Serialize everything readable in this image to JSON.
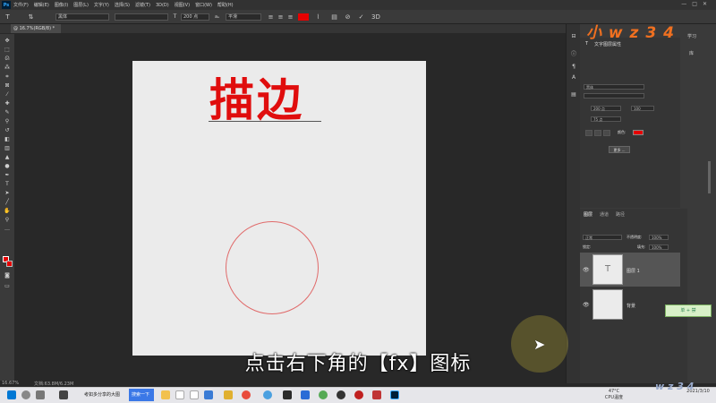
{
  "menubar": {
    "logo": "Ps",
    "items": [
      "文件(F)",
      "编辑(E)",
      "图像(I)",
      "图层(L)",
      "文字(Y)",
      "选择(S)",
      "滤镜(T)",
      "3D(D)",
      "视图(V)",
      "窗口(W)",
      "帮助(H)"
    ],
    "window_controls": "—□✕"
  },
  "options_bar": {
    "font_family": "黑体",
    "font_size": "200 点",
    "antialias": "平滑",
    "text_color": "#e60000"
  },
  "document": {
    "tab_label": "@ 16.7%(RGB/8) *",
    "canvas_text": "描边"
  },
  "subtitle": "点击右下角的【fx】图标",
  "status_bar": {
    "zoom": "16.67%",
    "doc_info": "文档:63.8M/6.23M"
  },
  "right_panel": {
    "learn": "学习",
    "libraries": "库",
    "char_panel_title": "文字图层属性",
    "font_family": "黑体",
    "font_size": "200 点",
    "tracking": "100",
    "leading": "75 点",
    "color_label": "颜色:",
    "more_button": "更多 ...",
    "text_color": "#e60000"
  },
  "layers_panel": {
    "tabs": [
      "图层",
      "通道",
      "路径"
    ],
    "blend_mode": "正常",
    "opacity_label": "不透明度:",
    "opacity_value": "100%",
    "lock_label": "锁定:",
    "fill_label": "填充:",
    "fill_value": "100%",
    "layers": [
      {
        "name": "图层 1",
        "thumb_glyph": "T"
      },
      {
        "name": "背景"
      }
    ]
  },
  "watermark": {
    "top": "小 w z 3 4",
    "bottom": "w z 3 4"
  },
  "sticker": "单 + 禁",
  "taskbar": {
    "apps": [
      "考如多分享的大图",
      "搜索一下"
    ],
    "temperature": "47°C",
    "cpu_label": "CPU温度",
    "date": "2021/3/10"
  }
}
